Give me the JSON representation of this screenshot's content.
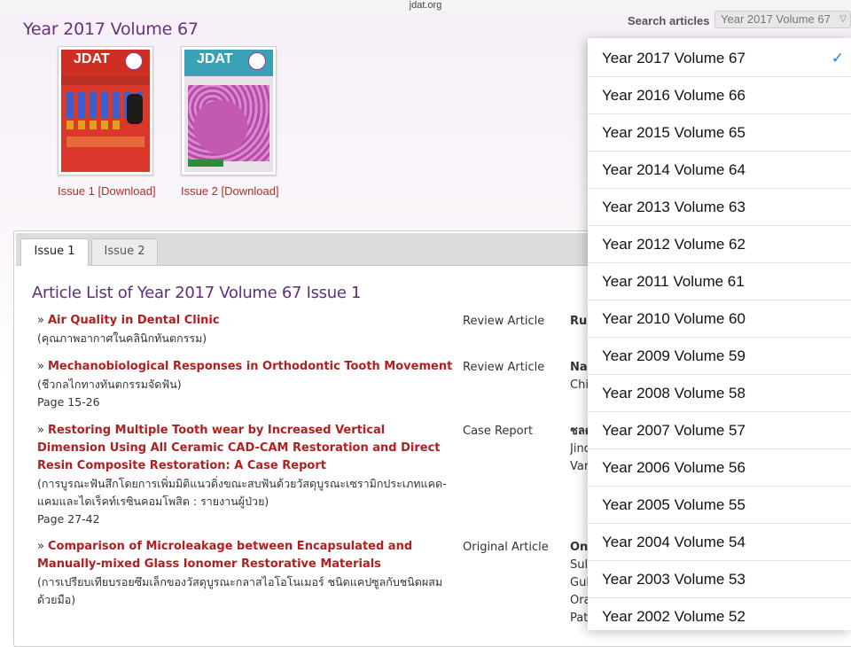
{
  "browser": {
    "domain": "jdat.org"
  },
  "header": {
    "year_title": "Year 2017 Volume 67",
    "search_label": "Search articles",
    "search_selected": "Year 2017 Volume 67"
  },
  "issues": [
    {
      "cover_logo": "JDAT",
      "link": "Issue 1 [Download]"
    },
    {
      "cover_logo": "JDAT",
      "link": "Issue 2 [Download]"
    }
  ],
  "tabs": [
    {
      "label": "Issue 1",
      "active": true
    },
    {
      "label": "Issue 2",
      "active": false
    }
  ],
  "article_list_title": "Article List of Year 2017 Volume 67 Issue 1",
  "articles": [
    {
      "title": "Air Quality in Dental Clinic",
      "thai": "(คุณภาพอากาศในคลินิกทันตกรรม)",
      "pages": "",
      "type": "Review Article",
      "author_lines": [
        "Ru"
      ]
    },
    {
      "title": "Mechanobiological Responses in Orthodontic Tooth Movement",
      "thai": "(ชีวกลไกทางทันตกรรมจัดฟัน)",
      "pages": "Page 15-26",
      "type": "Review Article",
      "author_lines": [
        "Na",
        "Chi"
      ]
    },
    {
      "title": "Restoring Multiple Tooth wear by Increased Vertical Dimension Using All Ceramic CAD-CAM Restoration and Direct Resin Composite Restoration: A Case Report",
      "thai": "(การบูรณะฟันสึกโดยการเพิ่มมิติแนวดิ่งขณะสบฟันด้วยวัสดุบูรณะเซรามิกประเภทแคด-แคมและไดเร็คท์เรซินคอมโพสิต : รายงานผู้ป่วย)",
      "pages": "Page 27-42",
      "type": "Case Report",
      "author_lines": [
        "ชลด",
        "Jinc",
        "Var"
      ]
    },
    {
      "title": "Comparison of Microleakage between Encapsulated and Manually-mixed Glass Ionomer Restorative Materials",
      "thai": "(การเปรียบเทียบรอยซึมเล็กของวัสดุบูรณะกลาสไอโอโนเมอร์ ชนิดแคปซูลกับชนิดผสมด้วยมือ)",
      "pages": "",
      "type": "Original Article",
      "author_lines": [
        "On",
        "Sul",
        "Gul",
        "Ora",
        "Pati"
      ]
    }
  ],
  "dropdown": {
    "selected_index": 0,
    "items": [
      "Year 2017 Volume 67",
      "Year 2016 Volume 66",
      "Year 2015 Volume 65",
      "Year 2014 Volume 64",
      "Year 2013 Volume 63",
      "Year 2012 Volume 62",
      "Year 2011 Volume 61",
      "Year 2010 Volume 60",
      "Year 2009 Volume 59",
      "Year 2008 Volume 58",
      "Year 2007 Volume 57",
      "Year 2006 Volume 56",
      "Year 2005 Volume 55",
      "Year 2004 Volume 54",
      "Year 2003 Volume 53",
      "Year 2002 Volume 52"
    ],
    "check_icon": "checkmark-icon"
  }
}
